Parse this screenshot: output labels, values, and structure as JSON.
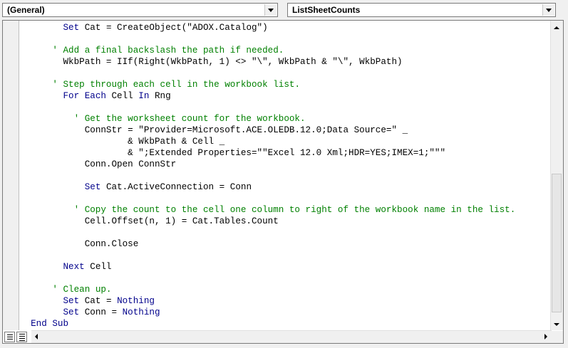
{
  "procedure_dropdown": {
    "selected": "(General)"
  },
  "object_dropdown": {
    "selected": "ListSheetCounts"
  },
  "code_lines": [
    {
      "indent": "        ",
      "segments": [
        {
          "t": "Set",
          "c": "kw"
        },
        {
          "t": " Cat = CreateObject(\"ADOX.Catalog\")",
          "c": ""
        }
      ]
    },
    {
      "indent": "",
      "segments": []
    },
    {
      "indent": "      ",
      "segments": [
        {
          "t": "' Add a final backslash the path if needed.",
          "c": "cm"
        }
      ]
    },
    {
      "indent": "        ",
      "segments": [
        {
          "t": "WkbPath = IIf(Right(WkbPath, 1) <> \"\\\", WkbPath & \"\\\", WkbPath)",
          "c": ""
        }
      ]
    },
    {
      "indent": "",
      "segments": []
    },
    {
      "indent": "      ",
      "segments": [
        {
          "t": "' Step through each cell in the workbook list.",
          "c": "cm"
        }
      ]
    },
    {
      "indent": "        ",
      "segments": [
        {
          "t": "For Each",
          "c": "kw"
        },
        {
          "t": " Cell ",
          "c": ""
        },
        {
          "t": "In",
          "c": "kw"
        },
        {
          "t": " Rng",
          "c": ""
        }
      ]
    },
    {
      "indent": "",
      "segments": []
    },
    {
      "indent": "          ",
      "segments": [
        {
          "t": "' Get the worksheet count for the workbook.",
          "c": "cm"
        }
      ]
    },
    {
      "indent": "            ",
      "segments": [
        {
          "t": "ConnStr = \"Provider=Microsoft.ACE.OLEDB.12.0;Data Source=\" _",
          "c": ""
        }
      ]
    },
    {
      "indent": "                    ",
      "segments": [
        {
          "t": "& WkbPath & Cell _",
          "c": ""
        }
      ]
    },
    {
      "indent": "                    ",
      "segments": [
        {
          "t": "& \";Extended Properties=\"\"Excel 12.0 Xml;HDR=YES;IMEX=1;\"\"\"",
          "c": ""
        }
      ]
    },
    {
      "indent": "            ",
      "segments": [
        {
          "t": "Conn.Open ConnStr",
          "c": ""
        }
      ]
    },
    {
      "indent": "",
      "segments": []
    },
    {
      "indent": "            ",
      "segments": [
        {
          "t": "Set",
          "c": "kw"
        },
        {
          "t": " Cat.ActiveConnection = Conn",
          "c": ""
        }
      ]
    },
    {
      "indent": "",
      "segments": []
    },
    {
      "indent": "          ",
      "segments": [
        {
          "t": "' Copy the count to the cell one column to right of the workbook name in the list.",
          "c": "cm"
        }
      ]
    },
    {
      "indent": "            ",
      "segments": [
        {
          "t": "Cell.Offset(n, 1) = Cat.Tables.Count",
          "c": ""
        }
      ]
    },
    {
      "indent": "",
      "segments": []
    },
    {
      "indent": "            ",
      "segments": [
        {
          "t": "Conn.Close",
          "c": ""
        }
      ]
    },
    {
      "indent": "",
      "segments": []
    },
    {
      "indent": "        ",
      "segments": [
        {
          "t": "Next",
          "c": "kw"
        },
        {
          "t": " Cell",
          "c": ""
        }
      ]
    },
    {
      "indent": "",
      "segments": []
    },
    {
      "indent": "      ",
      "segments": [
        {
          "t": "' Clean up.",
          "c": "cm"
        }
      ]
    },
    {
      "indent": "        ",
      "segments": [
        {
          "t": "Set",
          "c": "kw"
        },
        {
          "t": " Cat = ",
          "c": ""
        },
        {
          "t": "Nothing",
          "c": "kw"
        }
      ]
    },
    {
      "indent": "        ",
      "segments": [
        {
          "t": "Set",
          "c": "kw"
        },
        {
          "t": " Conn = ",
          "c": ""
        },
        {
          "t": "Nothing",
          "c": "kw"
        }
      ]
    },
    {
      "indent": "  ",
      "segments": [
        {
          "t": "End Sub",
          "c": "kw"
        }
      ]
    }
  ],
  "colors": {
    "keyword": "#00008b",
    "comment": "#008000",
    "text": "#000000"
  },
  "icons": {
    "procedure_view": "procedure-view-icon",
    "module_view": "full-module-view-icon"
  }
}
